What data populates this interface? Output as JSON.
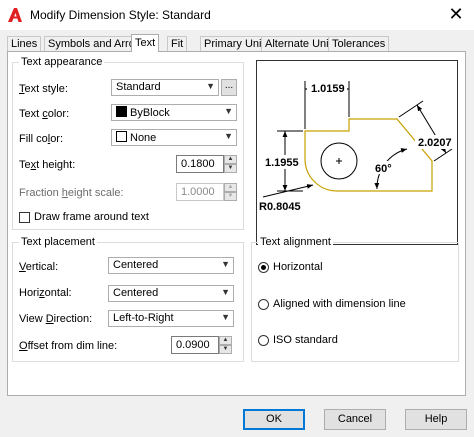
{
  "window": {
    "title": "Modify Dimension Style: Standard",
    "close_glyph": "✕",
    "app_icon": "autocad-a-icon"
  },
  "tabs": [
    {
      "label": "Lines",
      "active": false
    },
    {
      "label": "Symbols and Arrows",
      "active": false
    },
    {
      "label": "Text",
      "active": true
    },
    {
      "label": "Fit",
      "active": false
    },
    {
      "label": "Primary Units",
      "active": false
    },
    {
      "label": "Alternate Units",
      "active": false
    },
    {
      "label": "Tolerances",
      "active": false
    }
  ],
  "text_appearance": {
    "title": "Text appearance",
    "text_style_label": "Text style:",
    "text_style_value": "Standard",
    "text_style_browse": "...",
    "text_color_label": "Text color:",
    "text_color_value": "ByBlock",
    "fill_color_label": "Fill color:",
    "fill_color_value": "None",
    "text_height_label": "Text height:",
    "text_height_value": "0.1800",
    "fraction_label": "Fraction height scale:",
    "fraction_value": "1.0000",
    "draw_frame_label": "Draw frame around text",
    "draw_frame_checked": false
  },
  "text_placement": {
    "title": "Text placement",
    "vertical_label": "Vertical:",
    "vertical_value": "Centered",
    "horizontal_label": "Horizontal:",
    "horizontal_value": "Centered",
    "view_direction_label": "View Direction:",
    "view_direction_value": "Left-to-Right",
    "offset_label": "Offset from dim line:",
    "offset_value": "0.0900"
  },
  "text_alignment": {
    "title": "Text alignment",
    "options": [
      "Horizontal",
      "Aligned with dimension line",
      "ISO standard"
    ],
    "selected": "Horizontal"
  },
  "preview": {
    "dim_top": "1.0159",
    "dim_left": "1.1955",
    "dim_right": "2.0207",
    "dim_angle": "60°",
    "dim_radius": "R0.8045",
    "outline_color": "#c8a000"
  },
  "buttons": {
    "ok": "OK",
    "cancel": "Cancel",
    "help": "Help"
  }
}
